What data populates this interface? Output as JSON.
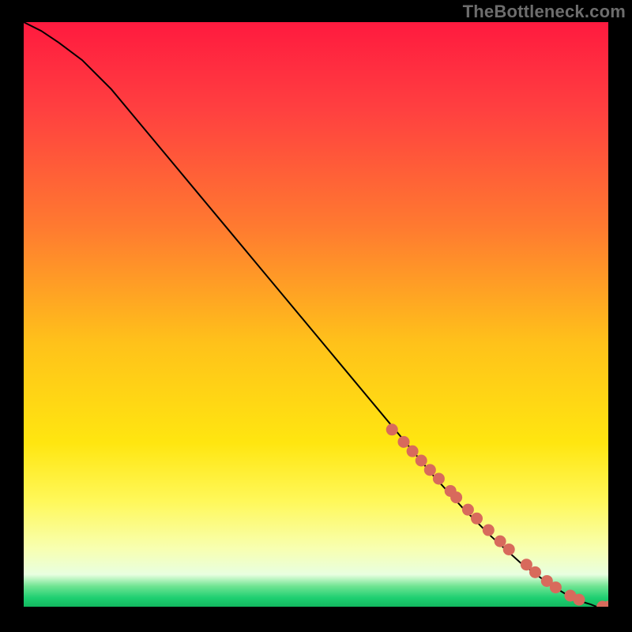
{
  "watermark": "TheBottleneck.com",
  "colors": {
    "gradient_stops": [
      {
        "offset": 0.0,
        "color": "#ff1a3f"
      },
      {
        "offset": 0.15,
        "color": "#ff4040"
      },
      {
        "offset": 0.35,
        "color": "#ff7a30"
      },
      {
        "offset": 0.55,
        "color": "#ffc21a"
      },
      {
        "offset": 0.72,
        "color": "#ffe610"
      },
      {
        "offset": 0.82,
        "color": "#fff85a"
      },
      {
        "offset": 0.9,
        "color": "#f8ffb0"
      },
      {
        "offset": 0.945,
        "color": "#e8ffe0"
      },
      {
        "offset": 0.965,
        "color": "#6fe492"
      },
      {
        "offset": 0.985,
        "color": "#1ecf71"
      },
      {
        "offset": 1.0,
        "color": "#12b85f"
      }
    ],
    "curve": "#000000",
    "marker": "#d86a5c",
    "frame": "#000000"
  },
  "chart_data": {
    "type": "line",
    "title": "",
    "xlabel": "",
    "ylabel": "",
    "xlim": [
      0,
      100
    ],
    "ylim": [
      0,
      100
    ],
    "grid": false,
    "series": [
      {
        "name": "bottleneck-curve",
        "x": [
          0,
          3,
          6,
          10,
          15,
          20,
          25,
          30,
          35,
          40,
          45,
          50,
          55,
          60,
          65,
          70,
          75,
          80,
          85,
          90,
          93,
          95,
          97,
          98,
          100
        ],
        "y": [
          100,
          98.5,
          96.5,
          93.5,
          88.5,
          82.5,
          76.5,
          70.5,
          64.5,
          58.5,
          52.5,
          46.5,
          40.5,
          34.5,
          28.5,
          22.5,
          17.0,
          12.0,
          7.5,
          3.8,
          2.0,
          1.0,
          0.4,
          0.0,
          0.0
        ]
      }
    ],
    "markers": {
      "name": "highlighted-points",
      "x": [
        63,
        65,
        66.5,
        68,
        69.5,
        71,
        73,
        74,
        76,
        77.5,
        79.5,
        81.5,
        83,
        86,
        87.5,
        89.5,
        91,
        93.5,
        95,
        99,
        100
      ],
      "y": [
        30.3,
        28.2,
        26.6,
        25.0,
        23.4,
        21.9,
        19.8,
        18.7,
        16.6,
        15.1,
        13.1,
        11.2,
        9.8,
        7.2,
        5.9,
        4.4,
        3.3,
        1.9,
        1.2,
        0.0,
        0.0
      ]
    }
  }
}
